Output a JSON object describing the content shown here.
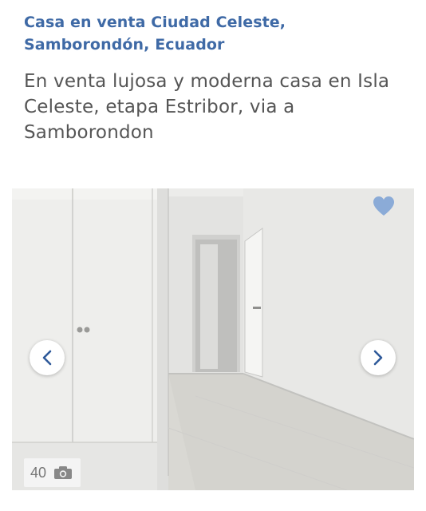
{
  "listing": {
    "location": "Casa en venta Ciudad Celeste, Samborondón, Ecuador",
    "headline": "En venta lujosa y moderna casa en Isla Celeste, etapa Estribor, via a Samborondon"
  },
  "gallery": {
    "photo_count": "40",
    "icons": {
      "prev": "chevron-left-icon",
      "next": "chevron-right-icon",
      "favorite": "heart-icon",
      "camera": "camera-icon"
    }
  },
  "colors": {
    "link": "#3f6aa6",
    "text": "#555555",
    "heart": "#7aa0d4",
    "chevron": "#2f5a9a"
  }
}
